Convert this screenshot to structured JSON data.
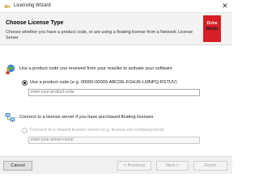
{
  "window": {
    "title": "Licensing Wizard",
    "close_glyph": "✕",
    "icon": "key-icon"
  },
  "header": {
    "title": "Choose License Type",
    "description": "Choose whether you have a product code, or are using a floating license from a Network License Server",
    "logo_line1": "Drive",
    "logo_line2": "Works"
  },
  "product_section": {
    "heading": "Use a product code you received from your reseller to activate your software",
    "icon": "globe-person-icon",
    "option_label": "Use a product code (e.g. 00000-00000-ABCDE-FGHJK-LMNPQ-RSTUV)",
    "option_selected": true,
    "input_placeholder": "enter-your-product-code"
  },
  "server_section": {
    "heading": "Connect to a license server if you have purchased floating licenses",
    "icon": "network-computers-icon",
    "option_label": "Connect to a shared license server (e.g. license.svr.company.local)",
    "option_selected": false,
    "input_placeholder": "enter-your-server-name"
  },
  "footer": {
    "cancel_label": "Cancel",
    "previous_label": "< Previous",
    "next_label": "Next >",
    "finish_label": "Finish"
  },
  "colors": {
    "logo_red": "#d61f26",
    "header_bg": "#f3f3f3"
  }
}
